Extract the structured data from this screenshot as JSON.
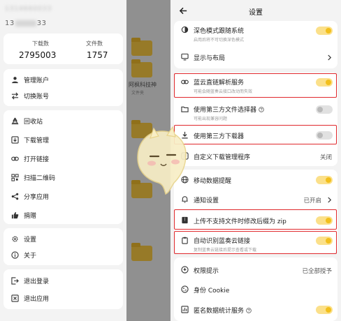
{
  "drawer": {
    "user_name": "1314660033",
    "user_id_prefix": "13",
    "user_id_suffix": "33",
    "stats": [
      {
        "label": "下载数",
        "value": "2795003"
      },
      {
        "label": "文件数",
        "value": "1757"
      }
    ],
    "groups": [
      [
        {
          "label": "管理账户",
          "icon": "person-icon"
        },
        {
          "label": "切换账号",
          "icon": "swap-icon"
        }
      ],
      [
        {
          "label": "回收站",
          "icon": "recycle-icon"
        },
        {
          "label": "下载管理",
          "icon": "download-box-icon"
        },
        {
          "label": "打开链接",
          "icon": "link-icon"
        },
        {
          "label": "扫描二维码",
          "icon": "qr-code-icon"
        },
        {
          "label": "分享应用",
          "icon": "share-icon"
        },
        {
          "label": "捐赠",
          "icon": "thumb-up-icon"
        }
      ],
      [
        {
          "label": "设置",
          "icon": "gear-icon"
        },
        {
          "label": "关于",
          "icon": "info-icon"
        }
      ],
      [
        {
          "label": "退出登录",
          "icon": "logout-icon"
        },
        {
          "label": "退出应用",
          "icon": "close-box-icon"
        }
      ]
    ]
  },
  "background_app": {
    "file_name": "阿枫科技神",
    "file_sub": "文件夹"
  },
  "settings": {
    "title": "设置",
    "items": [
      {
        "title": "深色模式跟随系统",
        "subtitle": "启用后将不可切换深色模式",
        "icon": "dark-mode-icon",
        "control": "toggle-on"
      },
      {
        "title": "显示与布局",
        "icon": "display-icon",
        "control": "chevron"
      },
      {
        "title": "蓝云直链解析服务",
        "subtitle": "可能会随蓝奏云接口改动而失效",
        "icon": "link-icon",
        "control": "toggle-on",
        "highlighted": true
      },
      {
        "title": "使用第三方文件选择器",
        "subtitle": "可能出现兼容问题",
        "icon": "folder-icon",
        "control": "toggle-off",
        "help": true
      },
      {
        "title": "使用第三方下载器",
        "icon": "download-icon",
        "control": "toggle-off",
        "highlighted": true
      },
      {
        "title": "自定义下载管理程序",
        "icon": "app-icon",
        "control": "value",
        "value": "关闭"
      },
      {
        "title": "移动数据提醒",
        "icon": "globe-icon",
        "control": "toggle-on"
      },
      {
        "title": "通知设置",
        "icon": "bell-icon",
        "control": "value-chevron",
        "value": "已开启"
      },
      {
        "title": "上传不支持文件时修改后缀为 zip",
        "icon": "zip-icon",
        "control": "toggle-on",
        "highlighted": true
      },
      {
        "title": "自动识别蓝奏云链接",
        "subtitle": "复制蓝奏云链接后提示查看或下载",
        "icon": "clipboard-icon",
        "control": "toggle-on",
        "highlighted": true
      },
      {
        "title": "权限提示",
        "icon": "permission-icon",
        "control": "value",
        "value": "已全部授予"
      },
      {
        "title": "身份 Cookie",
        "icon": "cookie-icon",
        "control": "none"
      },
      {
        "title": "匿名数据统计服务",
        "icon": "stats-icon",
        "control": "toggle-on",
        "help": true
      }
    ]
  },
  "colors": {
    "accent": "#f2bf1c",
    "highlight": "#e0282c",
    "background": "#f3f3f3",
    "card": "#ffffff"
  }
}
